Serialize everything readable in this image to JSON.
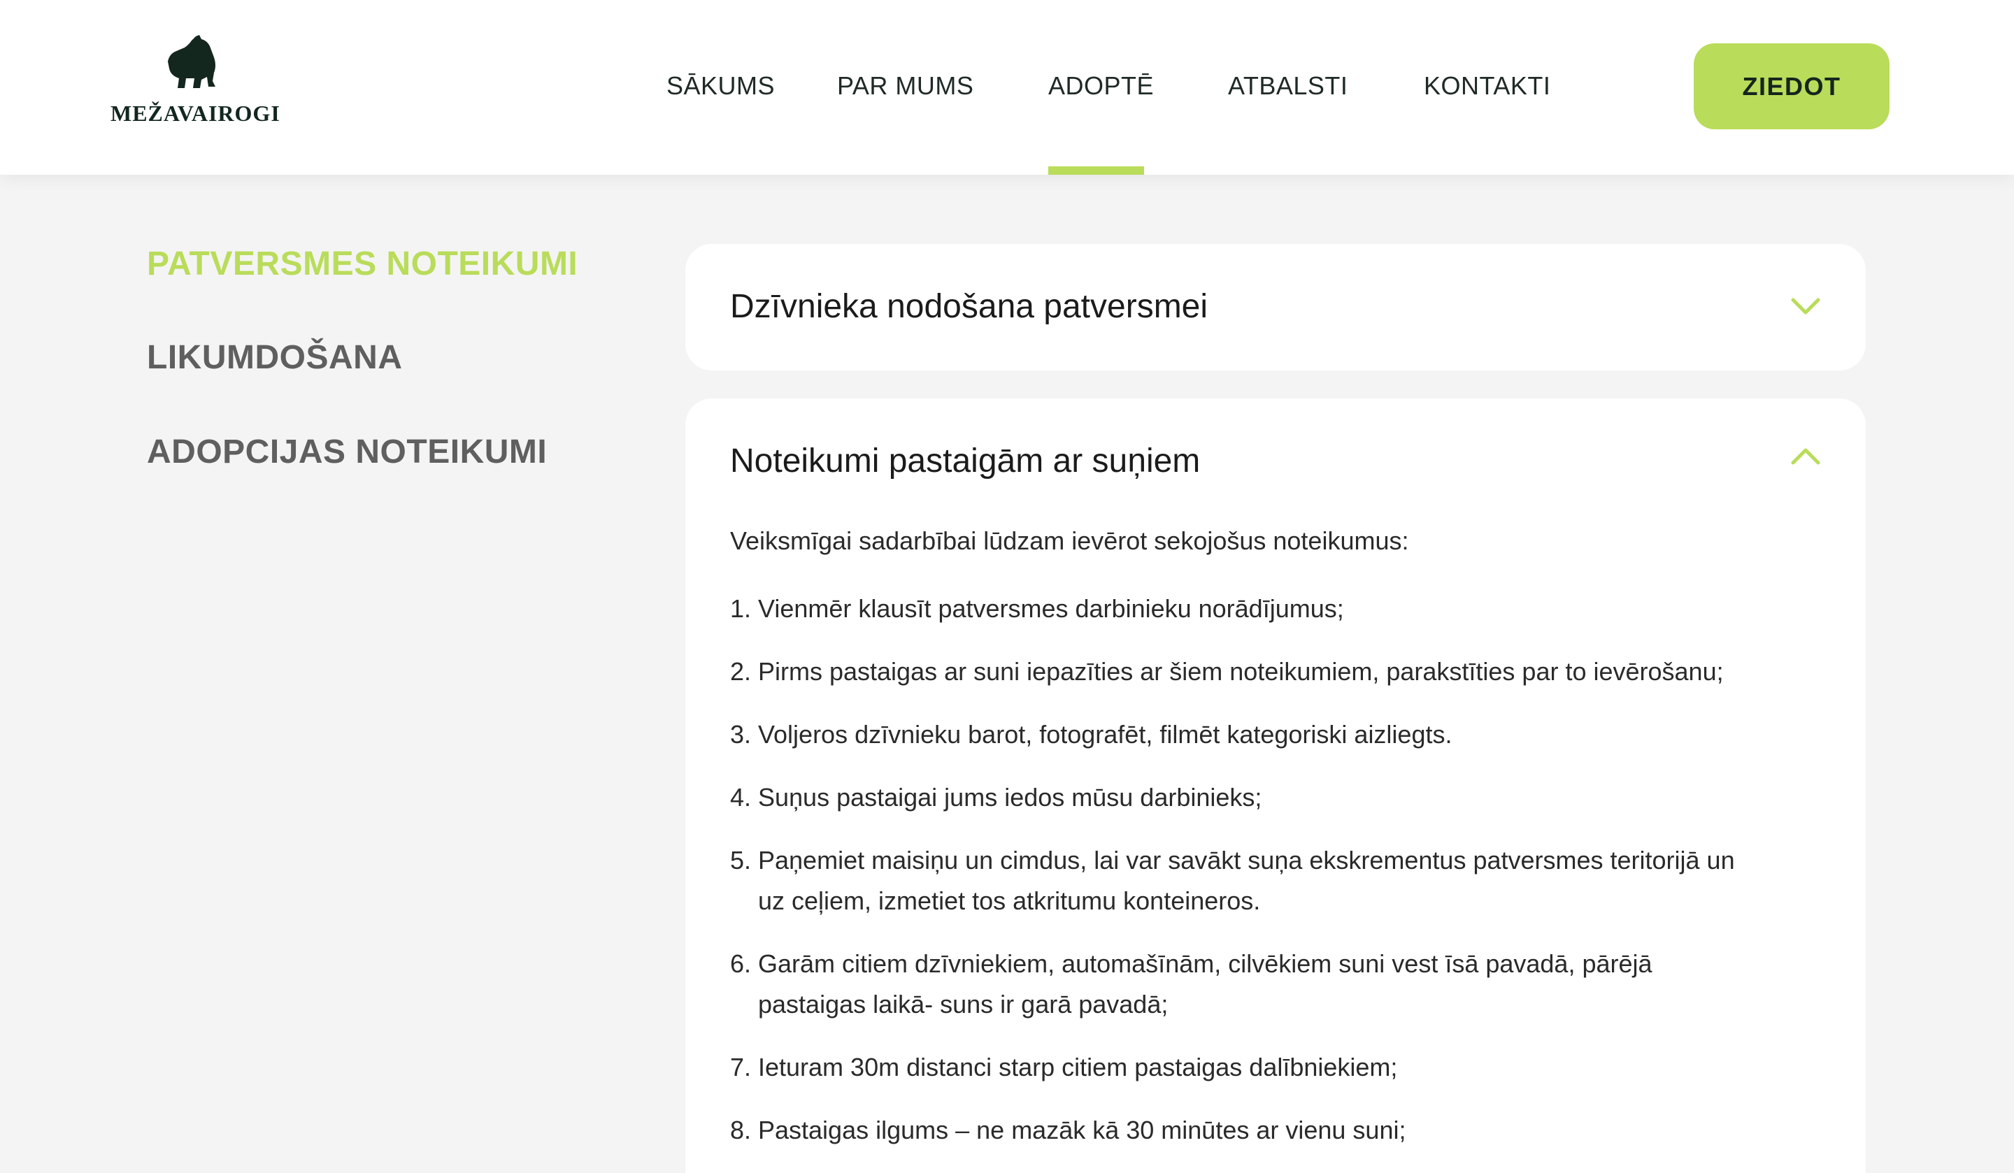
{
  "header": {
    "logo_text": "MEŽAVAIROGI",
    "nav": [
      {
        "label": "SĀKUMS"
      },
      {
        "label": "PAR MUMS"
      },
      {
        "label": "ADOPTĒ"
      },
      {
        "label": "ATBALSTI"
      },
      {
        "label": "KONTAKTI"
      }
    ],
    "active_nav": "ADOPTĒ",
    "donate_label": "ZIEDOT"
  },
  "sidebar": {
    "items": [
      {
        "label": "PATVERSMES NOTEIKUMI",
        "active": true
      },
      {
        "label": "LIKUMDOŠANA",
        "active": false
      },
      {
        "label": "ADOPCIJAS NOTEIKUMI",
        "active": false
      }
    ]
  },
  "accordion": [
    {
      "title": "Dzīvnieka nodošana patversmei",
      "expanded": false,
      "icon": "chevron-down-icon"
    },
    {
      "title": "Noteikumi pastaigām ar suņiem",
      "expanded": true,
      "icon": "chevron-up-icon",
      "intro": "Veiksmīgai sadarbībai lūdzam ievērot sekojošus noteikumus:",
      "rules": [
        {
          "num": "1.",
          "text": "Vienmēr klausīt patversmes darbinieku norādījumus;"
        },
        {
          "num": "2.",
          "text": "Pirms pastaigas ar suni iepazīties ar šiem noteikumiem, parakstīties par to ievērošanu;"
        },
        {
          "num": "3.",
          "text": "Voljeros dzīvnieku barot, fotografēt, filmēt kategoriski aizliegts."
        },
        {
          "num": "4.",
          "text": "Suņus pastaigai jums iedos mūsu darbinieks;"
        },
        {
          "num": "5.",
          "text": "Paņemiet maisiņu un cimdus, lai var savākt suņa ekskrementus patversmes teritorijā un uz ceļiem, izmetiet tos atkritumu konteineros."
        },
        {
          "num": "6.",
          "text": "Garām citiem dzīvniekiem, automašīnām, cilvēkiem suni vest īsā pavadā, pārējā pastaigas laikā- suns ir garā pavadā;"
        },
        {
          "num": "7.",
          "text": "Ieturam 30m distanci starp citiem pastaigas dalībniekiem;"
        },
        {
          "num": "8.",
          "text": "Pastaigas ilgums – ne mazāk kā 30 minūtes ar vienu suni;"
        }
      ]
    }
  ],
  "colors": {
    "accent": "#b9dc5a",
    "background": "#f4f4f4",
    "card": "#ffffff",
    "logo": "#13271e",
    "sidebar_inactive": "#5f5f5f"
  }
}
